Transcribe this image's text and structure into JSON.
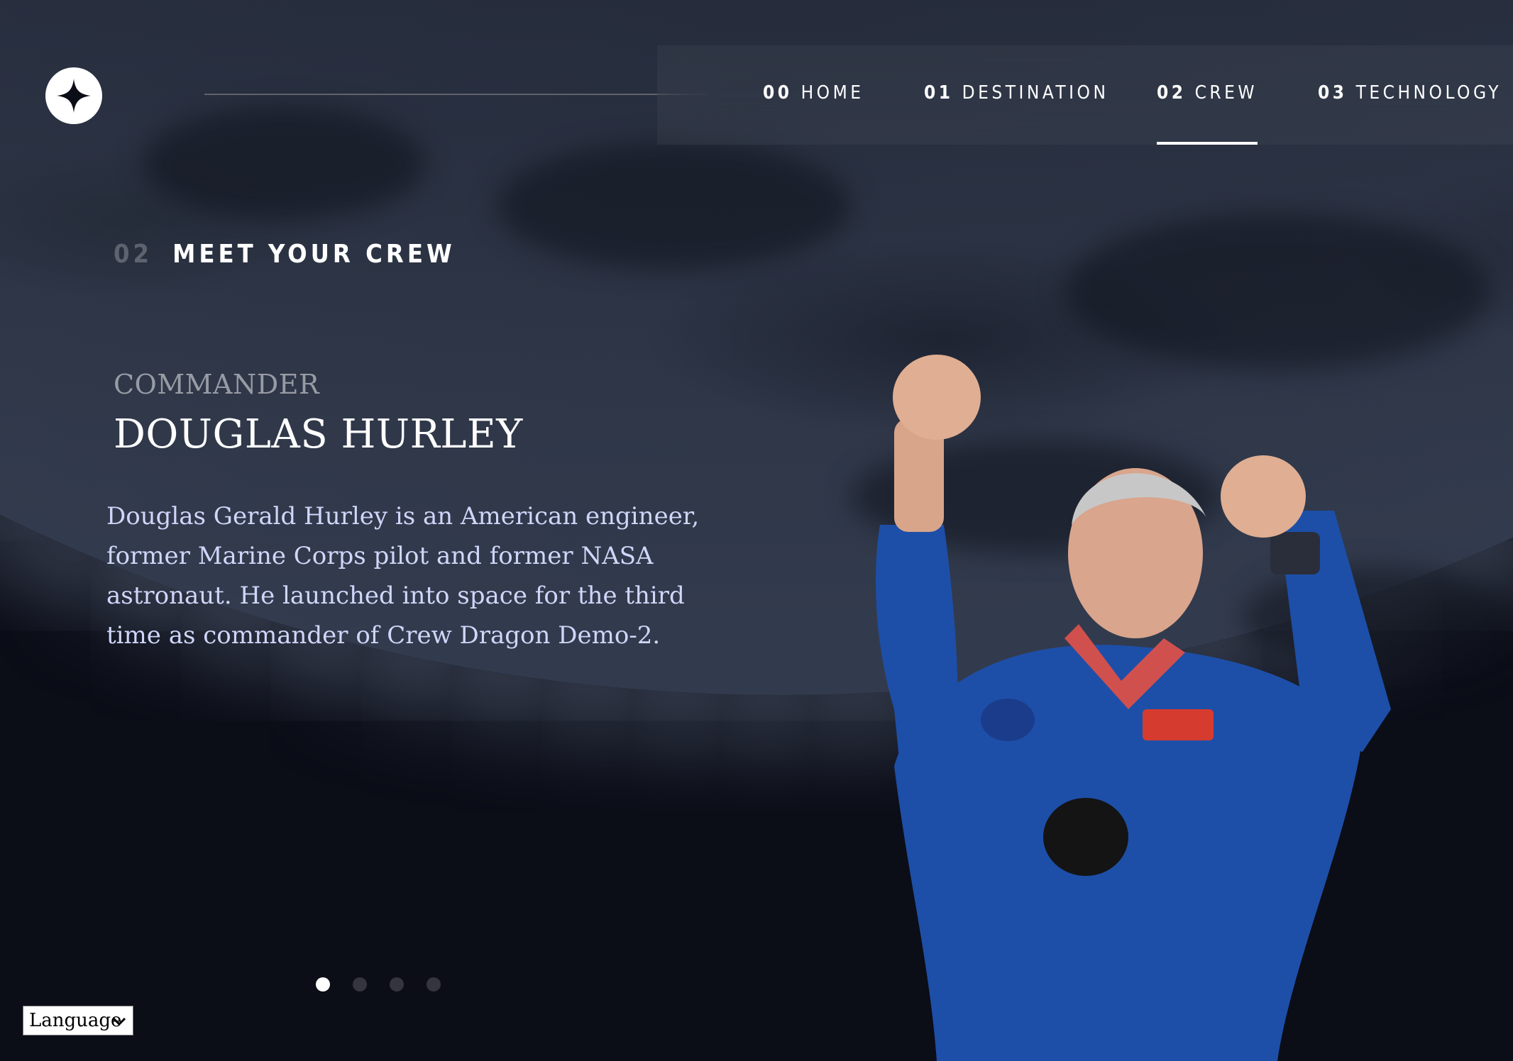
{
  "nav": {
    "items": [
      {
        "num": "00",
        "label": "HOME"
      },
      {
        "num": "01",
        "label": "DESTINATION"
      },
      {
        "num": "02",
        "label": "CREW"
      },
      {
        "num": "03",
        "label": "TECHNOLOGY"
      }
    ],
    "active_index": 2
  },
  "page": {
    "num": "02",
    "title": "MEET YOUR CREW"
  },
  "crew": {
    "role": "COMMANDER",
    "name": "DOUGLAS HURLEY",
    "bio": "Douglas Gerald Hurley is an American engineer, former Marine Corps pilot and former NASA astronaut. He launched into space for the third time as commander of Crew Dragon Demo-2."
  },
  "slider": {
    "count": 4,
    "active_index": 0
  },
  "language": {
    "label": "Language"
  },
  "icons": {
    "logo": "star-logo-icon",
    "language_chevron": "chevron-down-icon"
  },
  "colors": {
    "background": "#0b0d17",
    "text": "#ffffff",
    "body_text": "#d0d6f9",
    "suit_blue": "#1d4fa8"
  }
}
